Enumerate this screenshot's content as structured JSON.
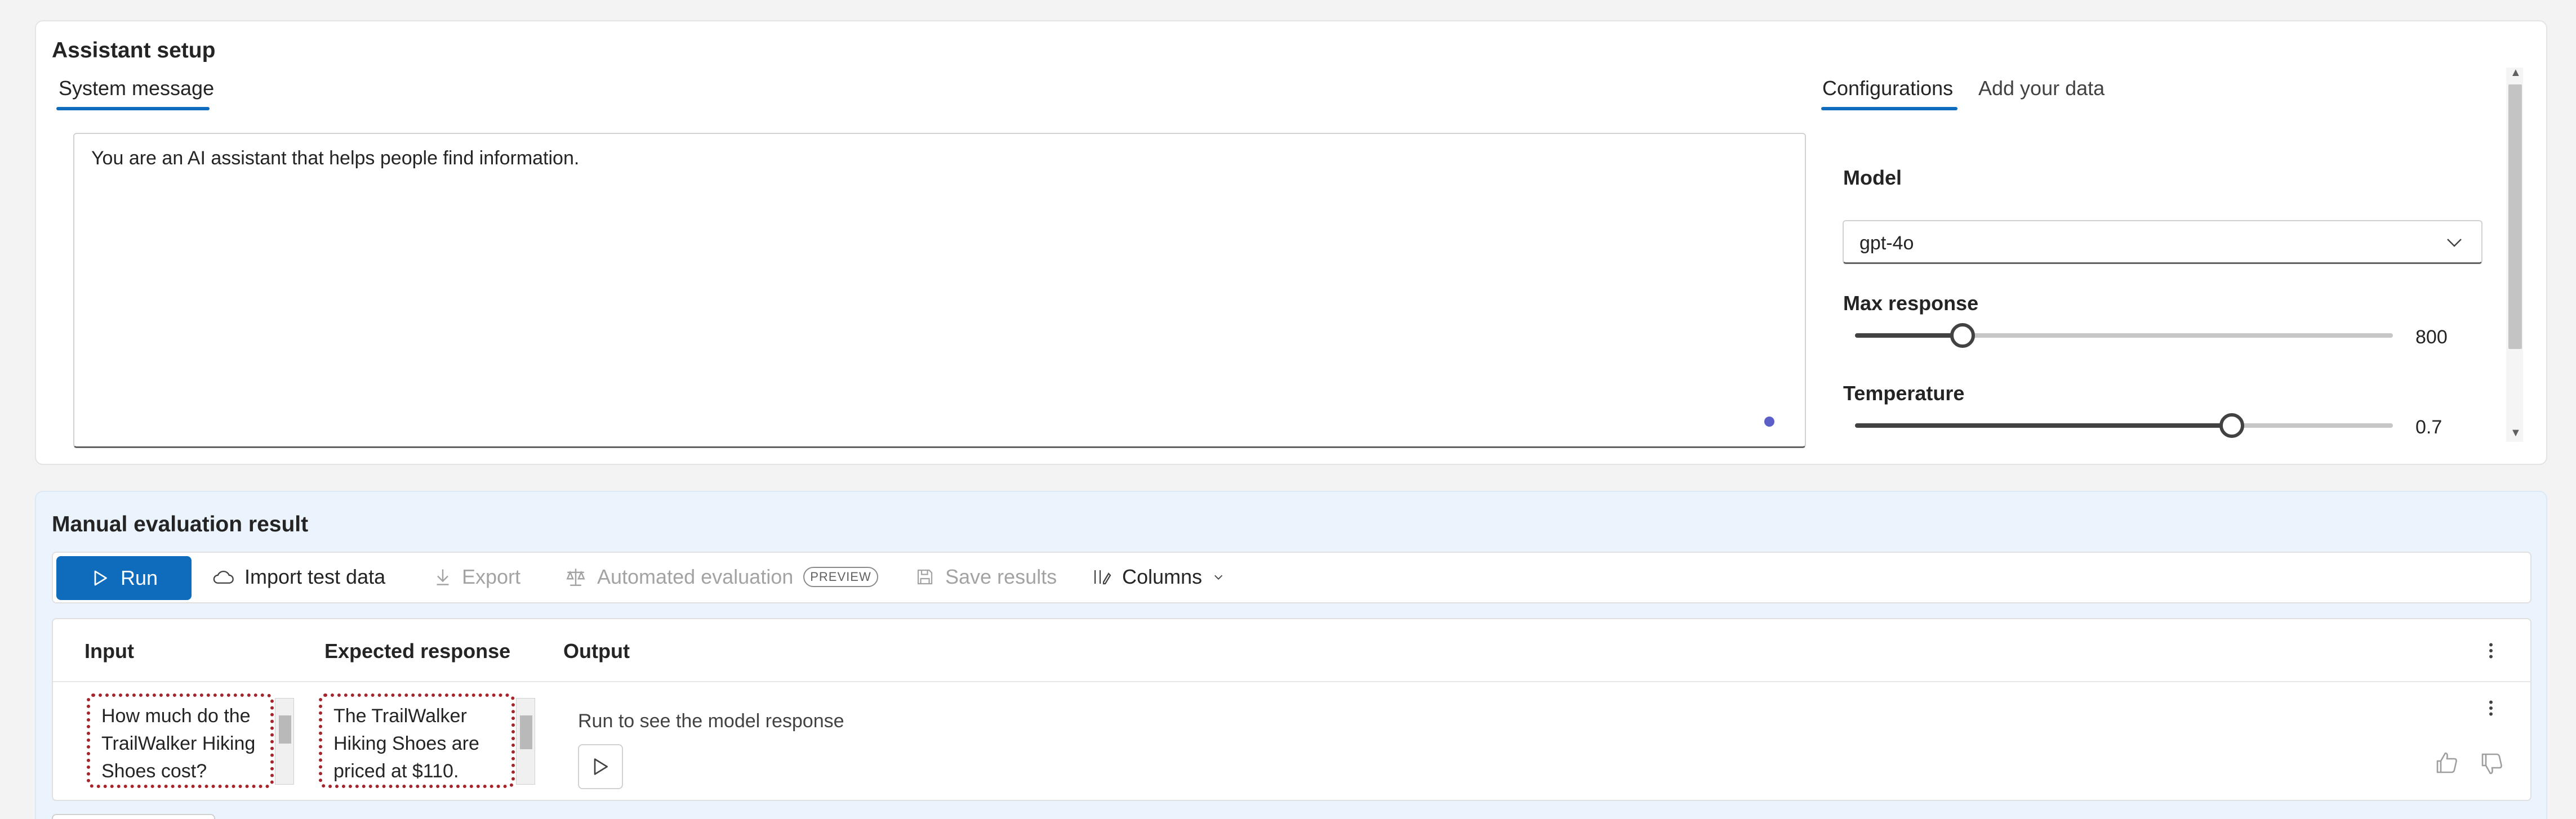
{
  "setup": {
    "title": "Assistant setup",
    "tabs_left": [
      "System message"
    ],
    "system_message": "You are an AI assistant that helps people find information.",
    "tabs_right": [
      "Configurations",
      "Add your data"
    ],
    "model": {
      "label": "Model",
      "value": "gpt-4o"
    },
    "max_response": {
      "label": "Max response",
      "value": "800",
      "fraction": 0.2
    },
    "temperature": {
      "label": "Temperature",
      "value": "0.7",
      "fraction": 0.7
    }
  },
  "evaluation": {
    "title": "Manual evaluation result",
    "toolbar": {
      "run": "Run",
      "import": "Import test data",
      "export": "Export",
      "automated": "Automated evaluation",
      "preview_badge": "PREVIEW",
      "save": "Save results",
      "columns": "Columns"
    },
    "table": {
      "headers": [
        "Input",
        "Expected response",
        "Output"
      ],
      "rows": [
        {
          "input": "How much do the TrailWalker Hiking Shoes cost?",
          "expected": "The TrailWalker Hiking Shoes are priced at $110.",
          "output": "Run to see the model response"
        }
      ]
    }
  },
  "colors": {
    "accent": "#0f6cbd",
    "dot": "#5b5fc7",
    "invalid_border": "#a4262c",
    "eval_background": "#ebf3fc"
  }
}
